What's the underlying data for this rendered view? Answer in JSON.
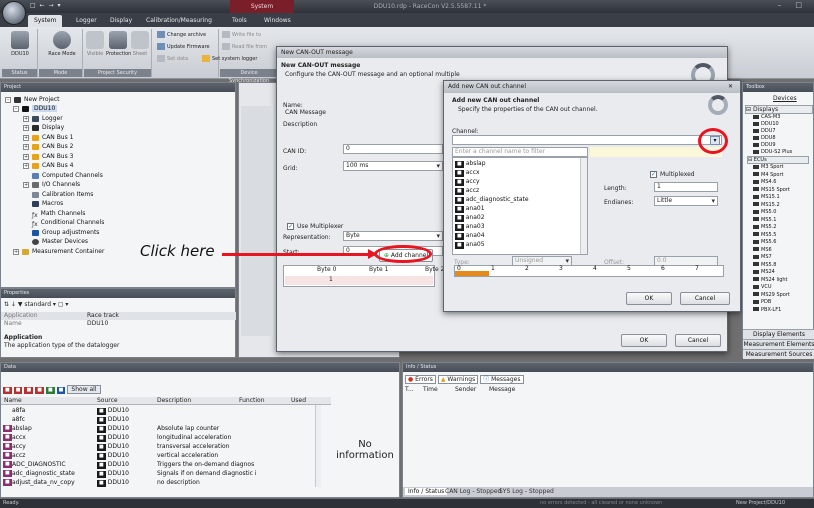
{
  "app": {
    "window_title": "DDU10.rdp - RaceCon V2.5.5587.11 *",
    "context_tab": "System",
    "qat": "□ ← → ▾"
  },
  "ribbon": {
    "tabs": [
      "System",
      "Logger",
      "Display",
      "Calibration/Measuring",
      "Tools",
      "Windows"
    ],
    "groups": [
      {
        "label": "Status",
        "items": [
          "DDU10"
        ]
      },
      {
        "label": "Mode",
        "items": [
          "Race Mode"
        ]
      },
      {
        "label": "Project Security",
        "items": [
          "Visible",
          "Protection",
          "Sheet",
          "locked"
        ]
      },
      {
        "label": "",
        "items": [
          "Change archive",
          "Update Firmware",
          "Set data"
        ]
      },
      {
        "label": "Device Synchronization",
        "items": [
          "Write file to",
          "Read file from",
          "Set system logger"
        ]
      }
    ]
  },
  "project": {
    "title": "Project",
    "items": [
      "New Project",
      "DDU10",
      "Logger",
      "Display",
      "CAN Bus 1",
      "CAN Bus 2",
      "CAN Bus 3",
      "CAN Bus 4",
      "Computed Channels",
      "I/O Channels",
      "Calibration Items",
      "Macros",
      "Math Channels",
      "Conditional Channels",
      "Group adjustments",
      "Master Devices",
      "Measurement Container"
    ]
  },
  "properties": {
    "title": "Properties",
    "sort": "standard",
    "rows": [
      {
        "k": "Application",
        "v": "Race track"
      },
      {
        "k": "Name",
        "v": "DDU10"
      }
    ],
    "desc_title": "Application",
    "desc_text": "The application type of the datalogger"
  },
  "annotation": {
    "text": "Click here"
  },
  "can_out": {
    "title": "New CAN-OUT message",
    "heading": "New CAN-OUT message",
    "subheading": "Configure the CAN-OUT message and an optional multiple",
    "name_label": "Name:",
    "name_value": "CAN Message",
    "desc_label": "Description",
    "canid_label": "CAN ID:",
    "canid_value": "0",
    "grid_label": "Grid:",
    "grid_value": "100 ms",
    "multiplexer_label": "Use Multiplexer",
    "repr_label": "Representation:",
    "repr_value": "Byte",
    "start_label": "Start:",
    "start_value": "0",
    "add_channel": "Add channel",
    "byte_headers": [
      "Byte 0",
      "Byte 1",
      "Byte 2"
    ],
    "row_value": "1",
    "ok": "OK",
    "cancel": "Cancel",
    "side_tabs": [
      "DDU",
      "CAN ID",
      "Baudr",
      "CAN bu",
      "CAN ID",
      "CAN ID",
      "Baudr",
      "CAN ID",
      "CAN ID",
      "CAN ID",
      "CAN co"
    ],
    "status": "Status"
  },
  "add_channel": {
    "title": "Add new CAN out channel",
    "heading": "Add new CAN out channel",
    "subheading": "Specify the properties of the CAN out channel.",
    "channel_label": "Channel:",
    "filter_placeholder": "Enter a channel name to filter",
    "channels": [
      "abslap",
      "accx",
      "accy",
      "accz",
      "adc_diagnostic_state",
      "ana01",
      "ana02",
      "ana03",
      "ana04",
      "ana05"
    ],
    "multiplexed": "Multiplexed",
    "length_label": "Length:",
    "length_value": "1",
    "endian_label": "Endianes:",
    "endian_value": "Little",
    "type_label": "Type:",
    "type_value": "Unsigned",
    "offset_label": "Offset:",
    "offset_value": "0.0",
    "bits": [
      "0",
      "1",
      "2",
      "3",
      "4",
      "5",
      "6",
      "7"
    ],
    "ok": "OK",
    "cancel": "Cancel"
  },
  "toolbox": {
    "title": "Toolbox",
    "devices": "Devices",
    "displays": "Displays",
    "ecus": "ECUs",
    "display_items": [
      "CAS-M3",
      "DDU10",
      "DDU7",
      "DDU8",
      "DDU9",
      "DDU-S2 Plus"
    ],
    "ecu_items": [
      "M3 Sport",
      "M4 Sport",
      "MS4.6",
      "MS15 Sport",
      "MS15.1",
      "MS15.2",
      "MS5.0",
      "MS5.1",
      "MS5.2",
      "MS5.5",
      "MS5.6",
      "MS6",
      "MS7",
      "MS5.8",
      "MS24",
      "MS24 light",
      "VCU",
      "MS29 Sport",
      "PDB",
      "PBX-LF1"
    ],
    "footer": [
      "Display Elements",
      "Measurement Elements",
      "Measurement Sources"
    ]
  },
  "data": {
    "title": "Data",
    "show_all": "Show all",
    "columns": [
      "Name",
      "Source",
      "Description",
      "Function",
      "Used"
    ],
    "rows": [
      {
        "name": "a8fa",
        "source": "DDU10",
        "desc": ""
      },
      {
        "name": "a8fc",
        "source": "DDU10",
        "desc": ""
      },
      {
        "name": "abslap",
        "source": "DDU10",
        "desc": "Absolute lap counter"
      },
      {
        "name": "accx",
        "source": "DDU10",
        "desc": "longitudinal acceleration"
      },
      {
        "name": "accy",
        "source": "DDU10",
        "desc": "transversal acceleration"
      },
      {
        "name": "accz",
        "source": "DDU10",
        "desc": "vertical acceleration"
      },
      {
        "name": "ADC_DIAGNOSTIC",
        "source": "DDU10",
        "desc": "Triggers the on-demand diagnos"
      },
      {
        "name": "adc_diagnostic_state",
        "source": "DDU10",
        "desc": "Signals if on demand diagnostic i"
      },
      {
        "name": "adjust_data_nv_copy",
        "source": "DDU10",
        "desc": "no description"
      }
    ],
    "no_info": "No information"
  },
  "info": {
    "title": "Info / Status",
    "errors": "Errors",
    "warnings": "Warnings",
    "messages": "Messages",
    "columns": [
      "T...",
      "Time",
      "Sender",
      "Message"
    ],
    "tabs": [
      "Info / Status",
      "CAN Log - Stopped",
      "SYS Log - Stopped"
    ]
  },
  "statusbar": {
    "left": "Ready.",
    "right": "no errors detected - all cleared or none unknown",
    "project": "New Project/DDU10"
  },
  "colors": {
    "accent_red": "#e8141f",
    "brand_dark": "#3a3f47",
    "selection_blue": "#1b55a8"
  }
}
